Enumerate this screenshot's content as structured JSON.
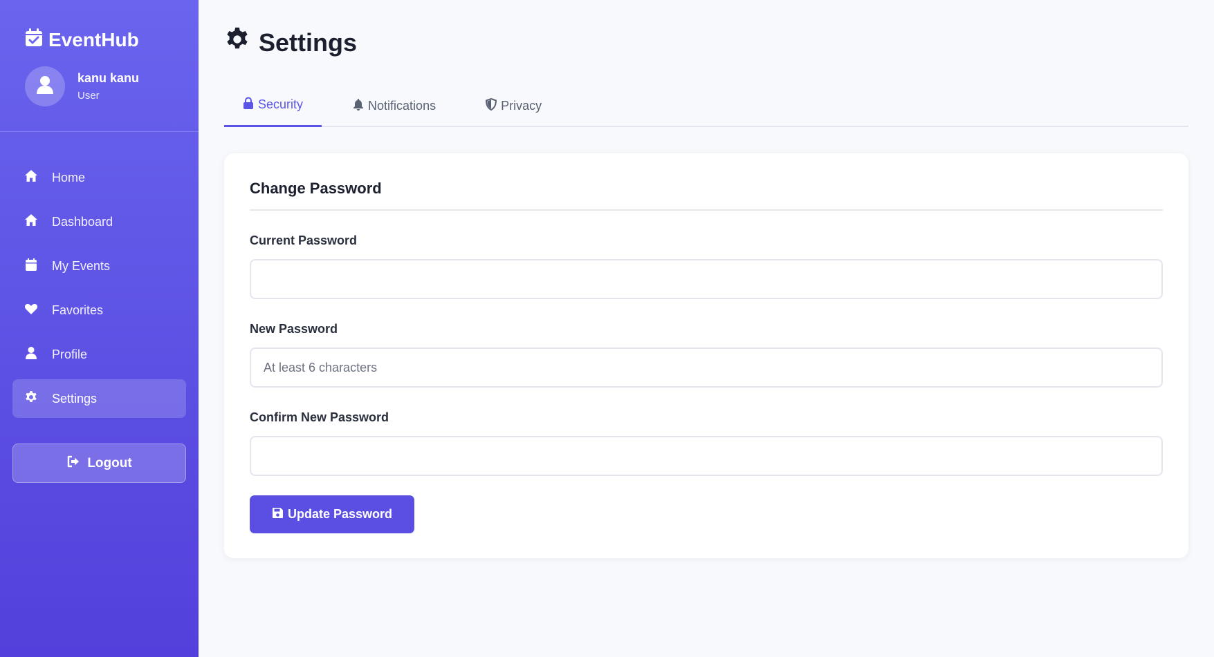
{
  "app": {
    "brand": "EventHub",
    "brand_icon": "calendar-check-icon"
  },
  "user": {
    "name": "kanu kanu",
    "role": "User"
  },
  "sidebar": {
    "items": [
      {
        "label": "Home",
        "icon": "home-icon"
      },
      {
        "label": "Dashboard",
        "icon": "home-icon"
      },
      {
        "label": "My Events",
        "icon": "calendar-icon"
      },
      {
        "label": "Favorites",
        "icon": "heart-icon"
      },
      {
        "label": "Profile",
        "icon": "user-icon"
      },
      {
        "label": "Settings",
        "icon": "gear-icon",
        "active": true
      }
    ],
    "logout_label": "Logout"
  },
  "page": {
    "title": "Settings",
    "title_icon": "gear-icon"
  },
  "tabs": [
    {
      "label": "Security",
      "icon": "lock-icon",
      "active": true
    },
    {
      "label": "Notifications",
      "icon": "bell-icon"
    },
    {
      "label": "Privacy",
      "icon": "shield-icon"
    }
  ],
  "form": {
    "title": "Change Password",
    "current_label": "Current Password",
    "current_value": "",
    "new_label": "New Password",
    "new_placeholder": "At least 6 characters",
    "new_value": "",
    "confirm_label": "Confirm New Password",
    "confirm_value": "",
    "submit_label": "Update Password"
  },
  "colors": {
    "accent": "#5b4fe3",
    "sidebar_top": "#6a64ee",
    "sidebar_bottom": "#5340dc",
    "background": "#f8f9fc"
  }
}
